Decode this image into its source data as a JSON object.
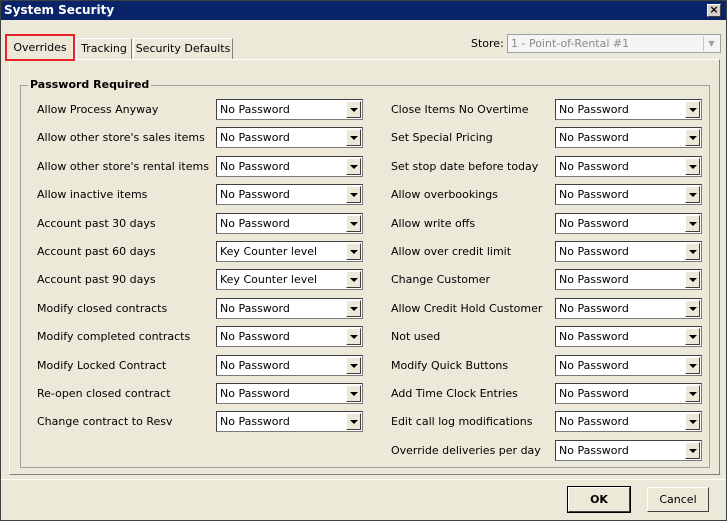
{
  "window": {
    "title": "System Security"
  },
  "tabs": [
    {
      "label": "Overrides",
      "active": true
    },
    {
      "label": "Tracking",
      "active": false
    },
    {
      "label": "Security Defaults",
      "active": false
    }
  ],
  "store": {
    "label": "Store:",
    "value": "1 - Point-of-Rental #1"
  },
  "group": {
    "title": "Password Required"
  },
  "left_rows": [
    {
      "label": "Allow Process Anyway",
      "value": "No Password"
    },
    {
      "label": "Allow other store's sales items",
      "value": "No Password"
    },
    {
      "label": "Allow other store's rental items",
      "value": "No Password"
    },
    {
      "label": "Allow inactive items",
      "value": "No Password"
    },
    {
      "label": "Account past 30 days",
      "value": "No Password"
    },
    {
      "label": "Account past 60 days",
      "value": "Key Counter level"
    },
    {
      "label": "Account past 90 days",
      "value": "Key Counter level"
    },
    {
      "label": "Modify closed contracts",
      "value": "No Password"
    },
    {
      "label": "Modify completed contracts",
      "value": "No Password"
    },
    {
      "label": "Modify Locked Contract",
      "value": "No Password"
    },
    {
      "label": "Re-open closed contract",
      "value": "No Password"
    },
    {
      "label": "Change contract to Resv",
      "value": "No Password"
    }
  ],
  "right_rows": [
    {
      "label": "Close Items No Overtime",
      "value": "No Password"
    },
    {
      "label": "Set Special Pricing",
      "value": "No Password"
    },
    {
      "label": "Set stop date before today",
      "value": "No Password"
    },
    {
      "label": "Allow overbookings",
      "value": "No Password"
    },
    {
      "label": "Allow write offs",
      "value": "No Password"
    },
    {
      "label": "Allow over credit limit",
      "value": "No Password"
    },
    {
      "label": "Change Customer",
      "value": "No Password"
    },
    {
      "label": "Allow Credit Hold Customer",
      "value": "No Password"
    },
    {
      "label": "Not used",
      "value": "No Password"
    },
    {
      "label": "Modify Quick Buttons",
      "value": "No Password"
    },
    {
      "label": "Add Time Clock Entries",
      "value": "No Password"
    },
    {
      "label": "Edit call log modifications",
      "value": "No Password"
    },
    {
      "label": "Override deliveries per day",
      "value": "No Password"
    }
  ],
  "buttons": {
    "ok": "OK",
    "cancel": "Cancel"
  },
  "icons": {
    "close": "close-icon",
    "dropdown": "chevron-down-icon"
  },
  "colors": {
    "titlebar": "#0a246a",
    "highlight": "#e8242b",
    "dialog_bg": "#ece9d8"
  }
}
